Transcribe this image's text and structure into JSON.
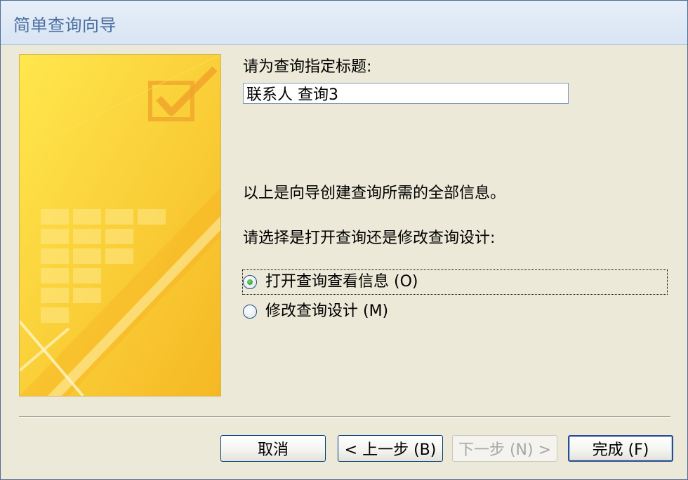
{
  "window": {
    "title": "简单查询向导"
  },
  "form": {
    "title_prompt": "请为查询指定标题:",
    "title_value": "联系人 查询3",
    "info_text": "以上是向导创建查询所需的全部信息。",
    "choice_prompt": "请选择是打开查询还是修改查询设计:",
    "options": [
      {
        "label": "打开查询查看信息 (O)",
        "selected": true
      },
      {
        "label": "修改查询设计 (M)",
        "selected": false
      }
    ]
  },
  "buttons": {
    "cancel": "取消",
    "back": "< 上一步 (B)",
    "next": "下一步 (N) >",
    "finish": "完成 (F)"
  },
  "colors": {
    "background": "#ece9d8",
    "title_text": "#4a6fa1",
    "art_yellow": "#ffcf33",
    "radio_selected": "#1f9b1f"
  }
}
